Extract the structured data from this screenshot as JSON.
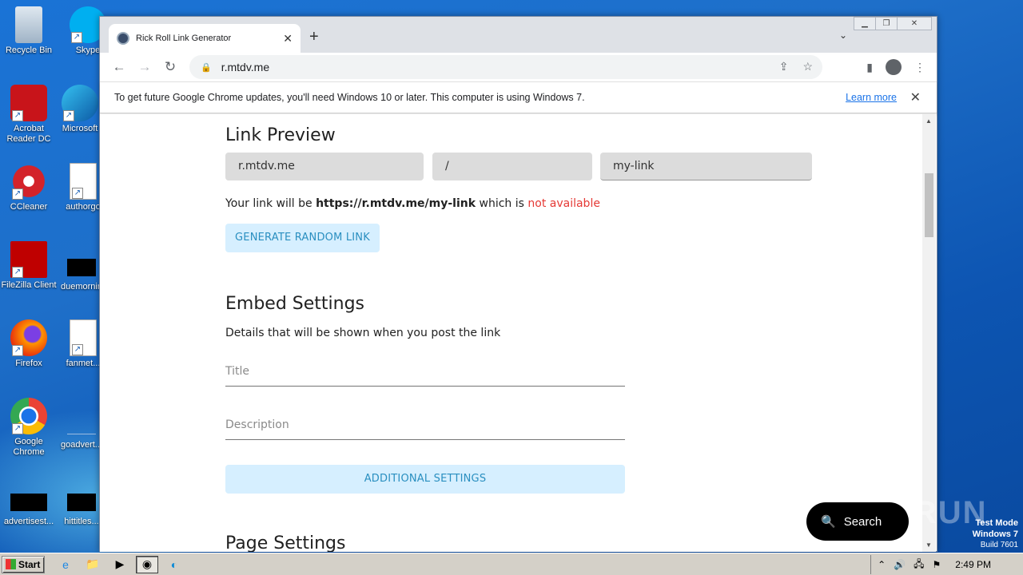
{
  "desktop": {
    "icons": [
      {
        "label": "Recycle Bin",
        "icon": "recycle-bin-icon"
      },
      {
        "label": "Skype",
        "icon": "skype-icon"
      },
      {
        "label": "Acrobat Reader DC",
        "icon": "acrobat-icon"
      },
      {
        "label": "Microsoft",
        "icon": "edge-icon"
      },
      {
        "label": "CCleaner",
        "icon": "ccleaner-icon"
      },
      {
        "label": "authorgo",
        "icon": "word-doc-icon"
      },
      {
        "label": "FileZilla Client",
        "icon": "filezilla-icon"
      },
      {
        "label": "duemornin",
        "icon": "blank-file-icon"
      },
      {
        "label": "Firefox",
        "icon": "firefox-icon"
      },
      {
        "label": "fanmet...",
        "icon": "word-doc-icon"
      },
      {
        "label": "Google Chrome",
        "icon": "chrome-icon"
      },
      {
        "label": "goadvert...",
        "icon": "blank-file-icon"
      },
      {
        "label": "advertisest...",
        "icon": "blank-file-icon"
      },
      {
        "label": "hittitles...",
        "icon": "blank-file-icon"
      }
    ],
    "watermark": "ANY RUN",
    "test_mode": {
      "line1": "Test Mode",
      "line2": "Windows 7",
      "line3": "Build 7601"
    },
    "search_pill": "Search"
  },
  "browser": {
    "tab_title": "Rick Roll Link Generator",
    "url": "r.mtdv.me",
    "infobar": {
      "message": "To get future Google Chrome updates, you'll need Windows 10 or later. This computer is using Windows 7.",
      "link": "Learn more"
    }
  },
  "page": {
    "link_preview": {
      "heading": "Link Preview",
      "domain": "r.mtdv.me",
      "separator": "/",
      "slug": "my-link",
      "sentence_prefix": "Your link will be ",
      "full_url": "https://r.mtdv.me/my-link",
      "sentence_mid": " which is ",
      "availability": "not available",
      "random_button": "GENERATE RANDOM LINK"
    },
    "embed_settings": {
      "heading": "Embed Settings",
      "subtitle": "Details that will be shown when you post the link",
      "title_placeholder": "Title",
      "description_placeholder": "Description",
      "additional_button": "ADDITIONAL SETTINGS"
    },
    "page_settings": {
      "heading": "Page Settings"
    }
  },
  "taskbar": {
    "start_label": "Start",
    "clock": "2:49 PM"
  }
}
